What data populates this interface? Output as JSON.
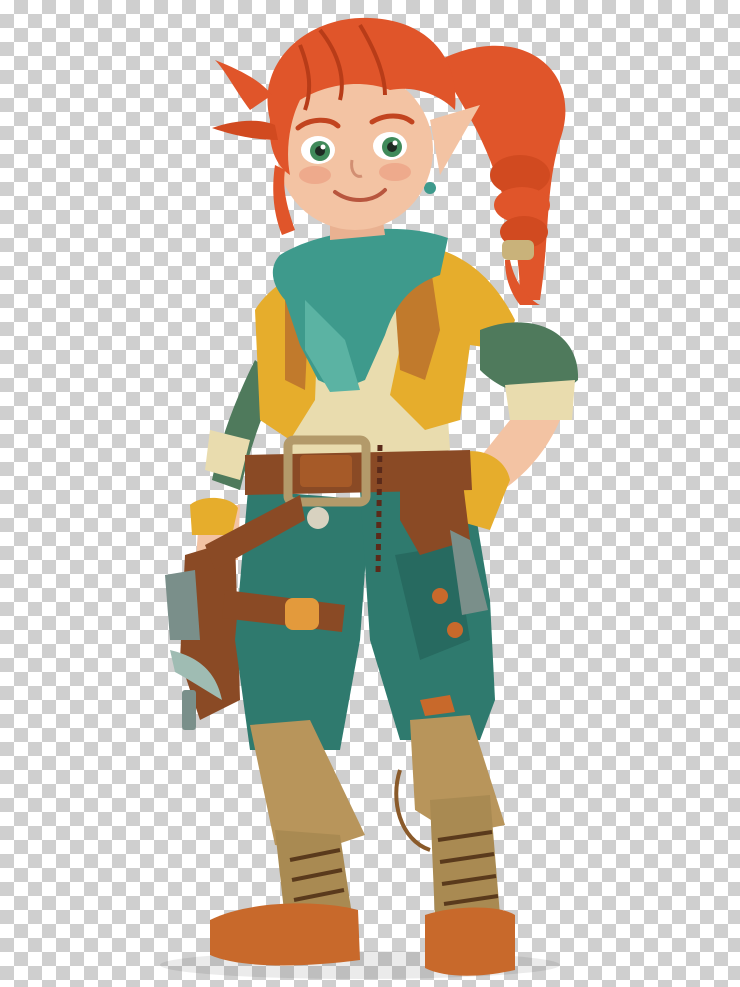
{
  "scene": {
    "background": "transparency-checkerboard",
    "subject": "elf-adventurer-girl",
    "colors": {
      "checker_light": "#ffffff",
      "checker_dark": "#cfcfcf",
      "hair": "#e0552a",
      "skin": "#f3c3a3",
      "scarf": "#3e9a8c",
      "jacket": "#e6ad2c",
      "shirt": "#e9dcae",
      "sleeves": "#4f7a5c",
      "pants": "#2f7a6e",
      "belt": "#8a4a25",
      "boots": "#b8955b",
      "shoes": "#c8692b"
    }
  }
}
